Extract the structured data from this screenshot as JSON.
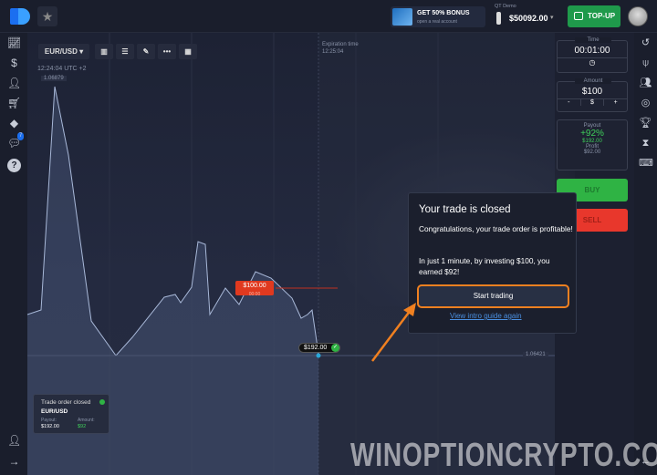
{
  "header": {
    "bonus_title": "GET 50% BONUS",
    "bonus_sub": "open a real account",
    "account_label": "QT Demo",
    "balance": "$50092.00",
    "topup_label": "TOP-UP"
  },
  "toolbar": {
    "pair": "EUR/USD ▾",
    "time": "12:24:04 UTC +2",
    "price_top": "1.06879"
  },
  "chart": {
    "expiration_label": "Expiration time",
    "expiration_time": "12:25:04",
    "trade_marker": "$100.00",
    "trade_marker_sub": "00:00",
    "result_marker": "$192.00",
    "price_right": "1.06421"
  },
  "panel": {
    "time_label": "Time",
    "time_value": "00:01:00",
    "amount_label": "Amount",
    "amount_value": "$100",
    "minus": "-",
    "currency": "$",
    "plus": "+",
    "payout_label": "Payout",
    "payout_pct": "+92%",
    "payout_value": "$192.00",
    "profit_label": "Profit",
    "profit_value": "$92.00",
    "buy": "BUY",
    "sell": "SELL"
  },
  "popup": {
    "title": "Your trade is closed",
    "line1": "Congratulations, your trade order is profitable!",
    "line2": "In just 1 minute, by investing $100, you earned $92!",
    "start": "Start trading",
    "guide": "View intro guide again"
  },
  "toast": {
    "title": "Trade order closed",
    "pair": "EUR/USD",
    "payout_label": "Payout:",
    "payout": "$192.00",
    "amount_label": "Amount:",
    "amount": "$92"
  },
  "sidebar": {
    "badge": "7"
  },
  "watermark": "WINOPTIONCRYPTO.COM",
  "colors": {
    "buy": "#2fb344",
    "sell": "#e8372c",
    "accent": "#f08020",
    "topup": "#1f9a4b"
  }
}
